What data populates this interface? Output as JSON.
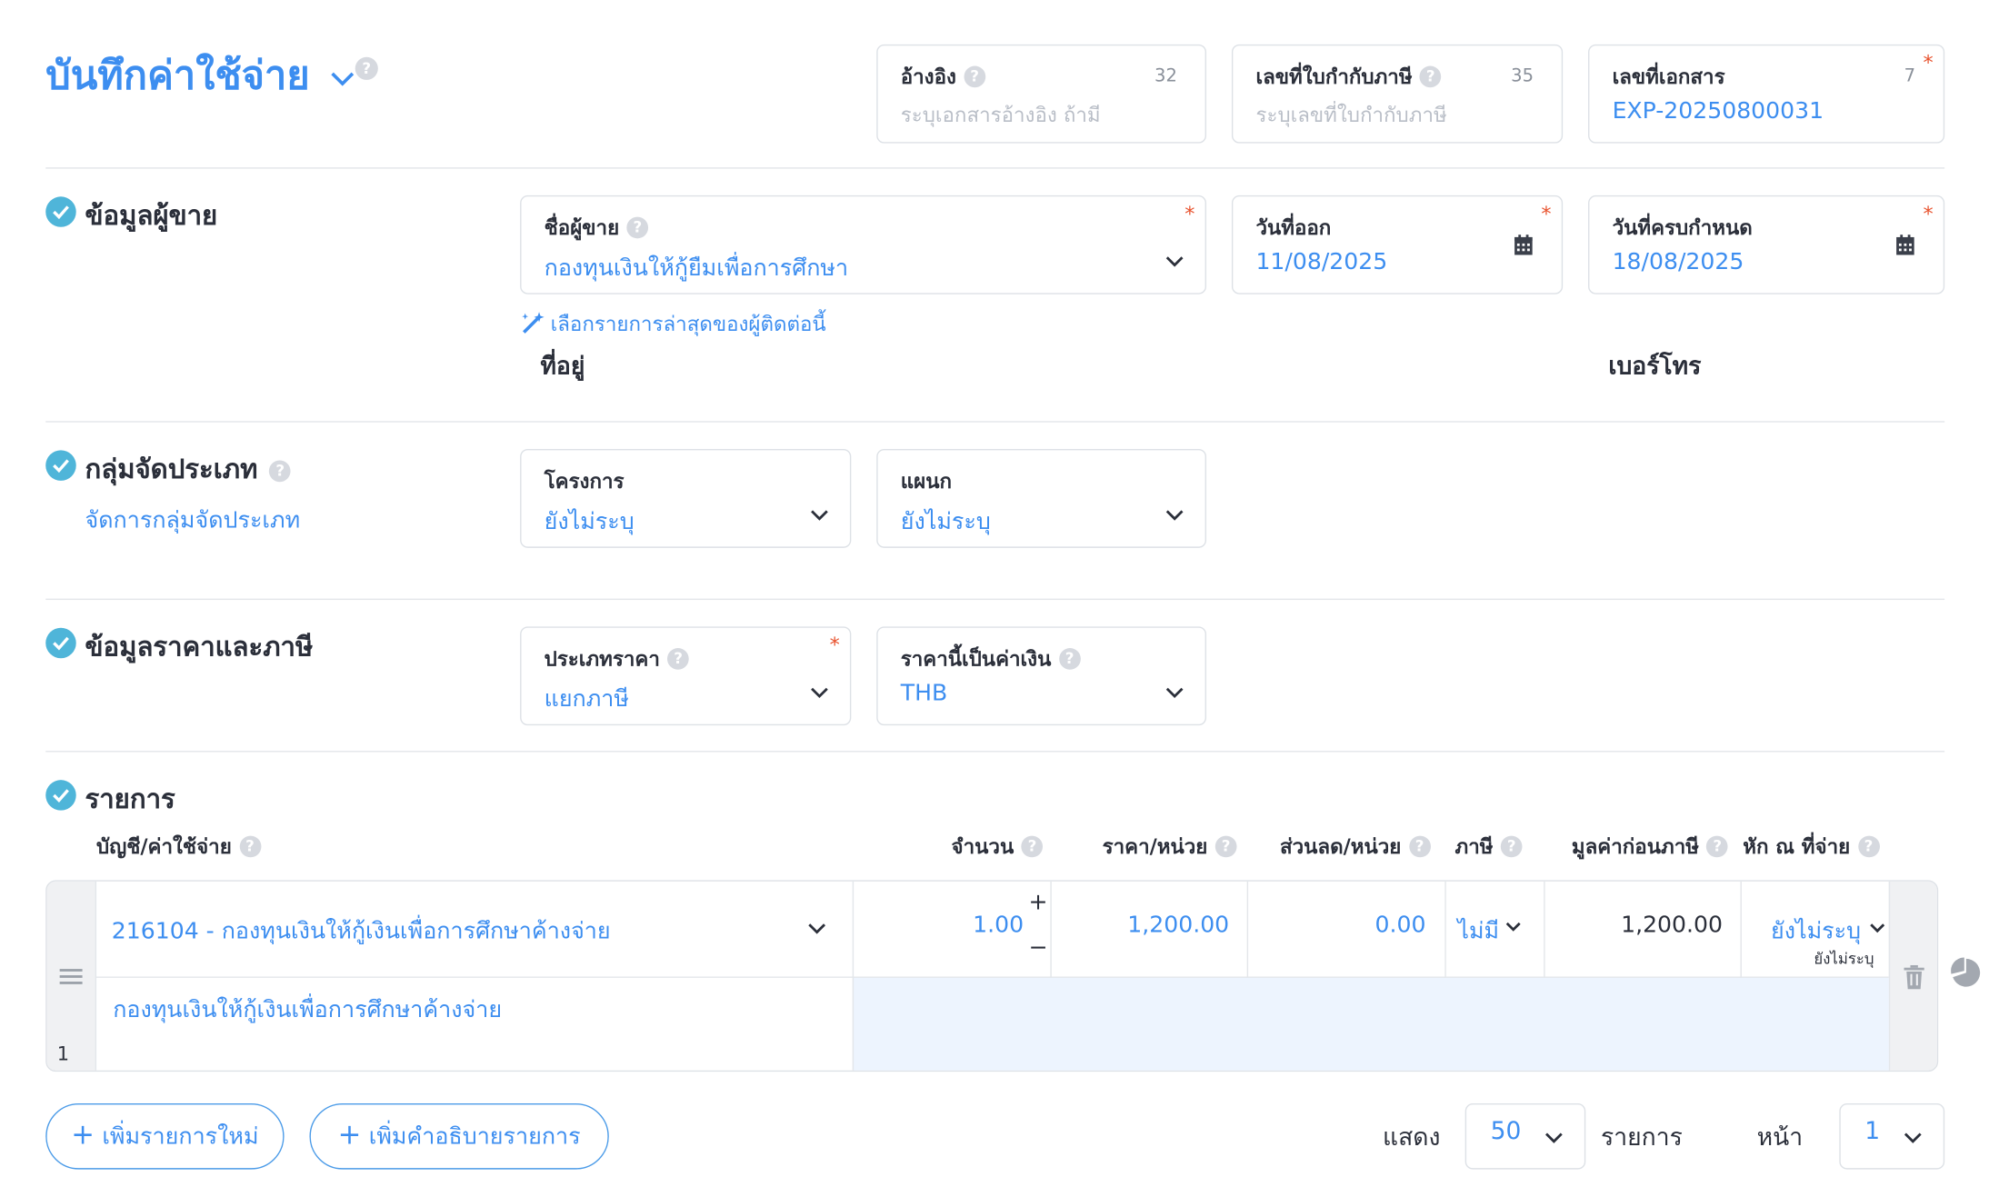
{
  "header": {
    "title": "บันทึกค่าใช้จ่าย",
    "reference": {
      "label": "อ้างอิง",
      "placeholder": "ระบุเอกสารอ้างอิง ถ้ามี",
      "max_chars": "32"
    },
    "tax_invoice_no": {
      "label": "เลขที่ใบกำกับภาษี",
      "placeholder": "ระบุเลขที่ใบกำกับภาษี",
      "max_chars": "35"
    },
    "document_no": {
      "label": "เลขที่เอกสาร",
      "value": "EXP-20250800031",
      "max_chars": "7",
      "required_mark": "*"
    }
  },
  "vendor_section": {
    "title": "ข้อมูลผู้ขาย",
    "vendor_name": {
      "label": "ชื่อผู้ขาย",
      "value": "กองทุนเงินให้กู้ยืมเพื่อการศึกษา",
      "required_mark": "*"
    },
    "issue_date": {
      "label": "วันที่ออก",
      "value": "11/08/2025",
      "required_mark": "*"
    },
    "due_date": {
      "label": "วันที่ครบกำหนด",
      "value": "18/08/2025",
      "required_mark": "*"
    },
    "recent_link": "เลือกรายการล่าสุดของผู้ติดต่อนี้",
    "address_label": "ที่อยู่",
    "phone_label": "เบอร์โทร"
  },
  "category_section": {
    "title": "กลุ่มจัดประเภท",
    "manage_link": "จัดการกลุ่มจัดประเภท",
    "project": {
      "label": "โครงการ",
      "value": "ยังไม่ระบุ"
    },
    "department": {
      "label": "แผนก",
      "value": "ยังไม่ระบุ"
    }
  },
  "price_section": {
    "title": "ข้อมูลราคาและภาษี",
    "price_type": {
      "label": "ประเภทราคา",
      "value": "แยกภาษี",
      "required_mark": "*"
    },
    "currency": {
      "label": "ราคานี้เป็นค่าเงิน",
      "value": "THB"
    }
  },
  "items_section": {
    "title": "รายการ",
    "columns": {
      "account": "บัญชี/ค่าใช้จ่าย",
      "quantity": "จำนวน",
      "unit_price": "ราคา/หน่วย",
      "discount": "ส่วนลด/หน่วย",
      "vat": "ภาษี",
      "pre_tax": "มูลค่าก่อนภาษี",
      "wht": "หัก ณ ที่จ่าย"
    },
    "rows": [
      {
        "index": "1",
        "account": "216104 - กองทุนเงินให้กู้เงินเพื่อการศึกษาค้างจ่าย",
        "quantity": "1.00",
        "unit_price": "1,200.00",
        "discount": "0.00",
        "vat": "ไม่มี",
        "pre_tax": "1,200.00",
        "wht": "ยังไม่ระบุ",
        "wht_sub": "ยังไม่ระบุ",
        "description": "กองทุนเงินให้กู้เงินเพื่อการศึกษาค้างจ่าย"
      }
    ],
    "stepper_plus": "+",
    "stepper_minus": "−"
  },
  "footer": {
    "add_item": "เพิ่มรายการใหม่",
    "add_description": "เพิ่มคำอธิบายรายการ",
    "plus_glyph": "+",
    "show_label": "แสดง",
    "page_size": "50",
    "items_label": "รายการ",
    "page_label": "หน้า",
    "page_number": "1"
  },
  "colors": {
    "accent": "#3d8ef0",
    "check": "#4fb5d9",
    "required": "#e8522e",
    "desc_highlight": "#edf4fe"
  },
  "icons": [
    "chevron-down-icon",
    "question-icon",
    "check-circle-icon",
    "calendar-icon",
    "magic-wand-icon",
    "drag-handle-icon",
    "trash-icon",
    "pie-chart-icon"
  ]
}
